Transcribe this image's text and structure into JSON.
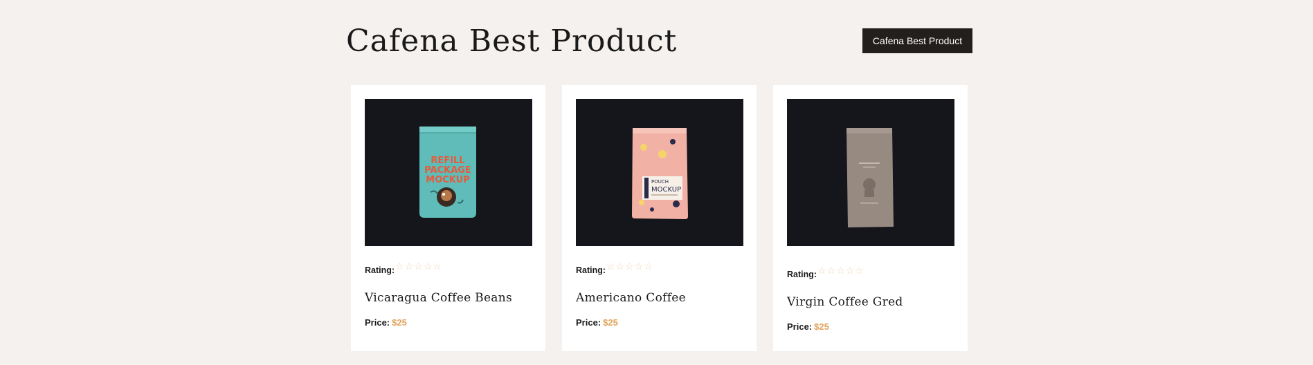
{
  "header": {
    "title": "Cafena Best Product",
    "button_label": "Cafena Best Product"
  },
  "colors": {
    "background": "#f4f1ee",
    "button_bg": "#231f1c",
    "price_accent": "#e0a45c",
    "star_outline": "#f0d6b8"
  },
  "products": [
    {
      "image_icon": "teal-refill-package-mockup",
      "image_text": [
        "REFILL",
        "PACKAGE",
        "MOCKUP"
      ],
      "rating_label": "Rating:",
      "stars": "☆☆☆☆☆",
      "rating": 0,
      "name": "Vicaragua Coffee Beans",
      "price_label": "Price:",
      "price": "$25"
    },
    {
      "image_icon": "pink-pouch-mockup",
      "image_text": [
        "POUCH",
        "MOCKUP"
      ],
      "rating_label": "Rating:",
      "stars": "☆☆☆☆☆",
      "rating": 0,
      "name": "Americano Coffee",
      "price_label": "Price:",
      "price": "$25"
    },
    {
      "image_icon": "taupe-coffee-bag",
      "image_text": [],
      "rating_label": "Rating:",
      "stars": "☆☆☆☆☆",
      "rating": 0,
      "name": "Virgin Coffee Gred",
      "price_label": "Price:",
      "price": "$25"
    }
  ]
}
